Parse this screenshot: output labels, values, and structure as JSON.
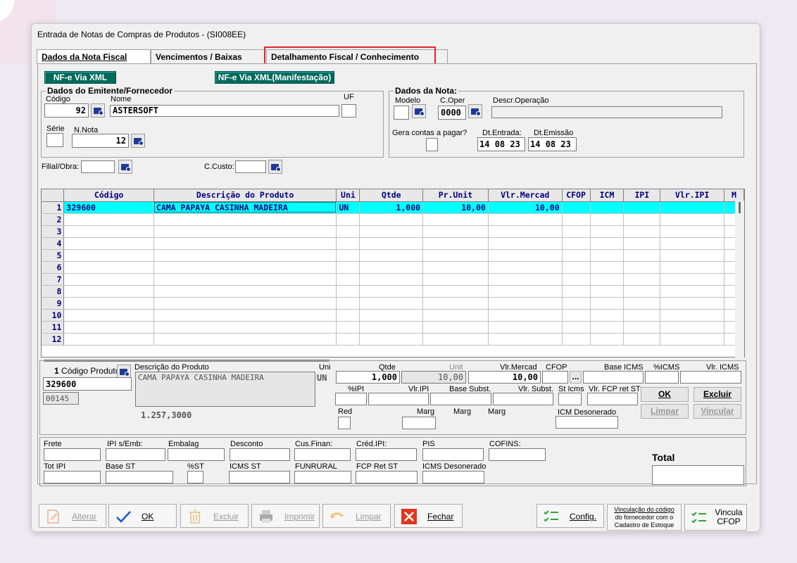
{
  "window_title": "Entrada de Notas de Compras de Produtos  - (SI008EE)",
  "tabs": [
    {
      "label": "Dados da Nota Fiscal"
    },
    {
      "label": "Vencimentos / Baixas"
    },
    {
      "label": "Detalhamento Fiscal / Conhecimento"
    }
  ],
  "xml_buttons": {
    "nfe_xml": "NF-e Via XML",
    "nfe_xml_manif": "NF-e Via XML(Manifestação)"
  },
  "emitente": {
    "legend": "Dados do Emitente/Fornecedor",
    "codigo_label": "Código",
    "codigo": "92",
    "nome_label": "Nome",
    "nome": "ASTERSOFT",
    "uf_label": "UF",
    "uf": "",
    "serie_label": "Série",
    "serie": "",
    "nnota_label": "N.Nota",
    "nnota": "12"
  },
  "nota": {
    "legend": "Dados da Nota:",
    "modelo_label": "Modelo",
    "modelo": "",
    "coper_label": "C.Oper",
    "coper": "0000",
    "descr_label": "Descr.Operação",
    "descr": "",
    "gera_label": "Gera contas a pagar?",
    "dt_entrada_label": "Dt.Entrada:",
    "dt_entrada": [
      "14",
      "08",
      "23"
    ],
    "dt_emissao_label": "Dt.Emissão",
    "dt_emissao": [
      "14",
      "08",
      "23"
    ]
  },
  "filial_label": "Filial/Obra:",
  "filial": "",
  "ccusto_label": "C.Custo:",
  "ccusto": "",
  "grid": {
    "headers": [
      "Código",
      "Descrição do Produto",
      "Uni",
      "Qtde",
      "Pr.Unit",
      "Vlr.Mercad",
      "CFOP",
      "ICM",
      "IPI",
      "Vlr.IPI",
      "M"
    ],
    "rows": [
      {
        "n": "1",
        "codigo": "329600",
        "descricao": "CAMA PAPAYA CASINHA MADEIRA",
        "uni": "UN",
        "qtde": "1,000",
        "prunit": "10,00",
        "vlrmercad": "10,00"
      },
      {
        "n": "2"
      },
      {
        "n": "3"
      },
      {
        "n": "4"
      },
      {
        "n": "5"
      },
      {
        "n": "6"
      },
      {
        "n": "7"
      },
      {
        "n": "8"
      },
      {
        "n": "9"
      },
      {
        "n": "10"
      },
      {
        "n": "11"
      },
      {
        "n": "12"
      }
    ]
  },
  "detail": {
    "item_num": "1",
    "codprod_label": "Código Produto",
    "codprod": "329600",
    "codprod2": "00145",
    "desc_label": "Descrição do Produto",
    "desc": "CAMA PAPAYA CASINHA MADEIRA",
    "desc_val": "1.257,3000",
    "uni_label": "Uni",
    "uni": "UN",
    "qtde_label": "Qtde",
    "qtde": "1,000",
    "unit_label": "Unit",
    "unit": "10,00",
    "vlrmercad_label": "Vlr.Mercad",
    "vlrmercad": "10,00",
    "cfop_label": "CFOP",
    "cfop_btn": "...",
    "base_icms_label": "Base ICMS",
    "pct_icms_label": "%ICMS",
    "vlr_icms_label": "Vlr. ICMS",
    "pct_ipi_label": "%IPI",
    "vlr_ipi_label": "Vlr.IPI",
    "base_subst_label": "Base Subst.",
    "vlr_subst_label": "Vlr. Subst.",
    "st_icms_label": "St Icms",
    "vlr_fcp_label": "Vlr. FCP ret ST",
    "red_label": "Red",
    "marg1_label": "Marg",
    "marg2_label": "Marg",
    "marg3_label": "Marg",
    "icm_deson_label": "ICM Desonerado",
    "ok": "OK",
    "excluir": "Excluir",
    "limpar": "Limpar",
    "vincular": "Vincular"
  },
  "totals": {
    "frete": "Frete",
    "ipi_emb": "IPI s/Emb:",
    "embalag": "Embalag",
    "desconto": "Desconto",
    "cus_finan": "Cus.Finan:",
    "cred_ipi": "Créd.IPI:",
    "pis": "PIS",
    "cofins": "COFINS:",
    "tot_ipi": "Tot IPI",
    "base_st": "Base ST",
    "pct_st": "%ST",
    "icms_st": "ICMS ST",
    "funrural": "FUNRURAL",
    "fcp_ret_st": "FCP Ret ST",
    "icms_deson": "ICMS Desonerado",
    "total": "Total"
  },
  "toolbar": {
    "alterar": "Alterar",
    "ok": "OK",
    "excluir": "Excluir",
    "imprimir": "Imprimir",
    "limpar": "Limpar",
    "fechar": "Fechar",
    "config": "Config.",
    "vinc_line1": "Vinculação do código",
    "vinc_line2": "do fornecedor com o",
    "vinc_line3": "Cadastro de Estoque",
    "vinc_cfop_1": "Vincula",
    "vinc_cfop_2": "CFOP"
  }
}
